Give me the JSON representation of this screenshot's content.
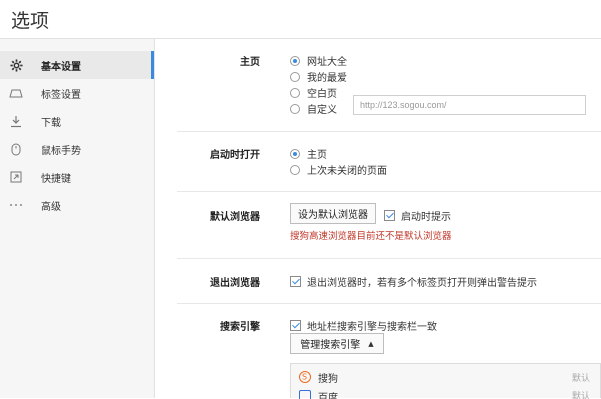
{
  "window": {
    "title": "选项"
  },
  "sidebar": {
    "items": [
      {
        "label": "基本设置",
        "icon": "gear-icon",
        "active": true
      },
      {
        "label": "标签设置",
        "icon": "tab-icon",
        "active": false
      },
      {
        "label": "下载",
        "icon": "download-icon",
        "active": false
      },
      {
        "label": "鼠标手势",
        "icon": "mouse-icon",
        "active": false
      },
      {
        "label": "快捷键",
        "icon": "shortcut-icon",
        "active": false
      },
      {
        "label": "高级",
        "icon": "more-icon",
        "active": false
      }
    ]
  },
  "homepage": {
    "label": "主页",
    "options": [
      "网址大全",
      "我的最爱",
      "空白页",
      "自定义"
    ],
    "selected": "网址大全",
    "custom_url": "http://123.sogou.com/"
  },
  "startup": {
    "label": "启动时打开",
    "options": [
      "主页",
      "上次未关闭的页面"
    ],
    "selected": "主页"
  },
  "default_browser": {
    "label": "默认浏览器",
    "button": "设为默认浏览器",
    "check_label": "启动时提示",
    "checked": true,
    "warning": "搜狗高速浏览器目前还不是默认浏览器"
  },
  "exit_browser": {
    "label": "退出浏览器",
    "check_label": "退出浏览器时，若有多个标签页打开则弹出警告提示",
    "checked": true
  },
  "search_engine": {
    "label": "搜索引擎",
    "check_label": "地址栏搜索引擎与搜索栏一致",
    "checked": true,
    "manage_button": "管理搜索引擎",
    "engines": [
      {
        "name": "搜狗",
        "default_label": "默认"
      },
      {
        "name": "百度",
        "default_label": "默认"
      }
    ]
  },
  "colors": {
    "accent": "#3a8be0",
    "warning": "#c0392b",
    "sogou_orange": "#f06a1e"
  }
}
